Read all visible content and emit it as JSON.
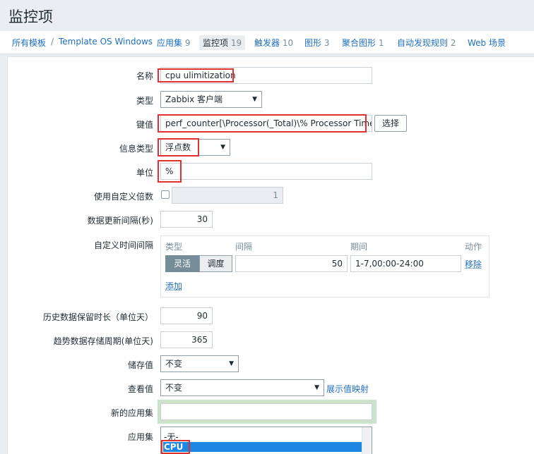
{
  "page": {
    "title": "监控项"
  },
  "breadcrumbs": [
    {
      "label": "所有模板",
      "count": ""
    },
    {
      "label": "Template OS Windows",
      "count": ""
    },
    {
      "label": "应用集",
      "count": "9"
    },
    {
      "label": "监控项",
      "count": "19"
    },
    {
      "label": "触发器",
      "count": "10"
    },
    {
      "label": "图形",
      "count": "3"
    },
    {
      "label": "聚合图形",
      "count": "1"
    },
    {
      "label": "自动发现规则",
      "count": "2"
    },
    {
      "label": "Web 场景",
      "count": ""
    }
  ],
  "breadcrumb_separator": "/",
  "form": {
    "name": {
      "label": "名称",
      "value": "cpu ulimitization"
    },
    "type": {
      "label": "类型",
      "value": "Zabbix 客户端"
    },
    "key": {
      "label": "键值",
      "value": "perf_counter[\\Processor(_Total)\\% Processor Time]",
      "button": "选择"
    },
    "info_type": {
      "label": "信息类型",
      "value": "浮点数"
    },
    "units": {
      "label": "单位",
      "value": "%"
    },
    "custom_multiplier": {
      "label": "使用自定义倍数",
      "value": "1"
    },
    "update_interval": {
      "label": "数据更新间隔(秒)",
      "value": "30"
    },
    "custom_intervals": {
      "label": "自定义时间间隔",
      "headers": {
        "type": "类型",
        "interval": "间隔",
        "period": "期间",
        "action": "动作"
      },
      "row": {
        "flexible": "灵活",
        "scheduling": "调度",
        "interval": "50",
        "period": "1-7,00:00-24:00",
        "remove": "移除"
      },
      "add": "添加"
    },
    "history": {
      "label": "历史数据保留时长（单位天）",
      "value": "90"
    },
    "trends": {
      "label": "趋势数据存储周期(单位天)",
      "value": "365"
    },
    "store_value": {
      "label": "储存值",
      "value": "不变"
    },
    "show_value": {
      "label": "查看值",
      "value": "不变",
      "link": "展示值映射"
    },
    "new_application": {
      "label": "新的应用集",
      "value": ""
    },
    "applications": {
      "label": "应用集",
      "options": [
        "-无-",
        "CPU"
      ],
      "selected": "CPU"
    }
  },
  "colors": {
    "link": "#1f6fbf",
    "highlight_box": "#e0302f",
    "selected": "#1e87e3",
    "glow": "#cbe4c9"
  }
}
